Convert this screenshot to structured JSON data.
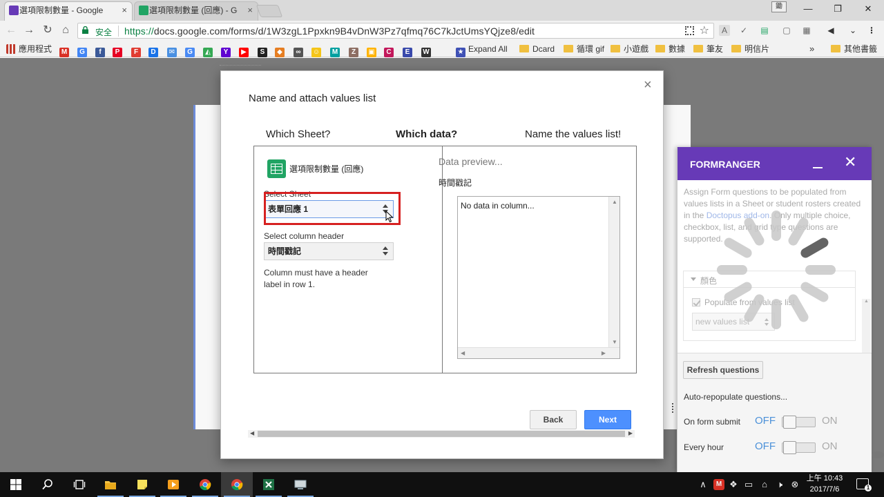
{
  "browser": {
    "tabs": [
      {
        "title": "選項限制數量 - Google",
        "icon_color": "#673ab7",
        "active": true
      },
      {
        "title": "選項限制數量 (回應) - Go",
        "icon_color": "#21a464",
        "active": false
      }
    ],
    "profile_label": "鋤",
    "window_controls": {
      "minimize": "—",
      "restore": "❐",
      "close": "✕"
    },
    "secure_label": "安全",
    "url_scheme": "https://",
    "url_rest": "docs.google.com/forms/d/1W3zgL1Ppxkn9B4vDnW3Pz7qfmq76C7kJctUmsYQjze8/edit",
    "bookmarks": [
      {
        "label": "應用程式",
        "type": "apps",
        "color": "#c0392b"
      },
      {
        "label": "",
        "type": "site",
        "glyph": "M",
        "color": "#d93025"
      },
      {
        "label": "",
        "type": "site",
        "glyph": "G",
        "color": "#4285f4"
      },
      {
        "label": "",
        "type": "site",
        "glyph": "f",
        "color": "#3b5998"
      },
      {
        "label": "",
        "type": "site",
        "glyph": "P",
        "color": "#e60023"
      },
      {
        "label": "",
        "type": "site",
        "glyph": "F",
        "color": "#e03c31"
      },
      {
        "label": "",
        "type": "site",
        "glyph": "D",
        "color": "#1a73e8"
      },
      {
        "label": "",
        "type": "site",
        "glyph": "✉",
        "color": "#4a90e2"
      },
      {
        "label": "",
        "type": "site",
        "glyph": "G",
        "color": "#4a8af4"
      },
      {
        "label": "",
        "type": "site",
        "glyph": "◭",
        "color": "#34a853"
      },
      {
        "label": "",
        "type": "site",
        "glyph": "Y",
        "color": "#5f01d1"
      },
      {
        "label": "",
        "type": "site",
        "glyph": "▶",
        "color": "#ff0000"
      },
      {
        "label": "",
        "type": "site",
        "glyph": "S",
        "color": "#222222"
      },
      {
        "label": "",
        "type": "site",
        "glyph": "◆",
        "color": "#e67e22"
      },
      {
        "label": "",
        "type": "site",
        "glyph": "∞",
        "color": "#555555"
      },
      {
        "label": "",
        "type": "site",
        "glyph": "☺",
        "color": "#f5c518"
      },
      {
        "label": "",
        "type": "site",
        "glyph": "M",
        "color": "#00a0a0"
      },
      {
        "label": "",
        "type": "site",
        "glyph": "Z",
        "color": "#8d6e63"
      },
      {
        "label": "",
        "type": "site",
        "glyph": "▣",
        "color": "#ffb300"
      },
      {
        "label": "",
        "type": "site",
        "glyph": "C",
        "color": "#c2185b"
      },
      {
        "label": "",
        "type": "site",
        "glyph": "E",
        "color": "#3949ab"
      },
      {
        "label": "",
        "type": "site",
        "glyph": "W",
        "color": "#333333"
      },
      {
        "label": "Expand All",
        "type": "site",
        "glyph": "★",
        "color": "#3f51b5"
      },
      {
        "label": "Dcard",
        "type": "folder"
      },
      {
        "label": "循環 gif",
        "type": "folder"
      },
      {
        "label": "小遊戲",
        "type": "folder"
      },
      {
        "label": "數據",
        "type": "folder"
      },
      {
        "label": "筆友",
        "type": "folder"
      },
      {
        "label": "明信片",
        "type": "folder"
      }
    ],
    "bookmarks_overflow": "»",
    "other_bookmarks": "其他書籤"
  },
  "modal": {
    "title": "Name and attach values list",
    "close_glyph": "×",
    "steps": [
      {
        "label": "Which Sheet?",
        "current": false
      },
      {
        "label": "Which data?",
        "current": true
      },
      {
        "label": "Name the values list!",
        "current": false
      }
    ],
    "sheet_file_name": "選項限制數量 (回應)",
    "select_sheet_label": "Select Sheet",
    "select_sheet_value": "表單回應 1",
    "select_column_label": "Select column header",
    "select_column_value": "時間戳記",
    "help_text": "Column must have a header label in row 1.",
    "preview_title": "Data preview...",
    "preview_column": "時間戳記",
    "preview_text": "No data in column...",
    "back_label": "Back",
    "next_label": "Next",
    "accent_color": "#4d90fe",
    "highlight_color": "#d62020"
  },
  "sidebar": {
    "title": "FORMRANGER",
    "header_color": "#673ab7",
    "close_glyph": "✕",
    "description_1": "Assign Form questions to be populated from values lists in a Sheet or student rosters created in the ",
    "description_link": "Doctopus add-on",
    "description_2": ". Only multiple choice, checkbox, list, and grid type questions are supported.",
    "section_name": "顏色",
    "populate_label": "Populate from values list",
    "values_select": "new values list",
    "refresh_label": "Refresh questions",
    "auto_label": "Auto-repopulate questions...",
    "toggles": [
      {
        "label": "On form submit",
        "off": "OFF",
        "on": "ON"
      },
      {
        "label": "Every hour",
        "off": "OFF",
        "on": "ON"
      }
    ]
  },
  "taskbar": {
    "apps": [
      "windows-start",
      "search",
      "task-view",
      "file-explorer",
      "sticky-notes",
      "media-player",
      "chrome",
      "chrome-active",
      "excel",
      "network-app"
    ],
    "time": "上午 10:43",
    "date": "2017/7/6",
    "notification_count": "1"
  }
}
